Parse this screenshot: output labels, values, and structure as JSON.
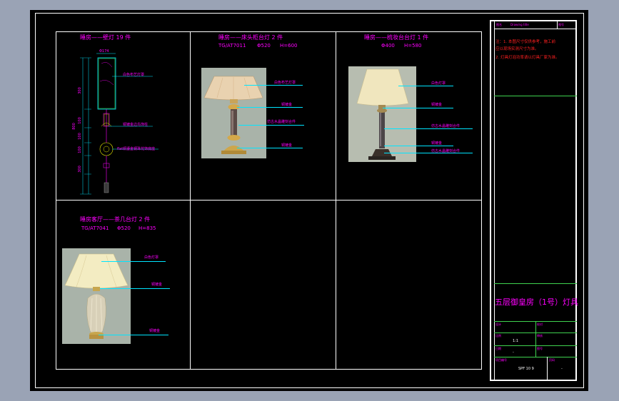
{
  "panels": [
    {
      "title": "睡房——壁灯 19 件",
      "dim_width": "Φ174",
      "dims": [
        "300",
        "300",
        "100",
        "100",
        "100",
        "300"
      ],
      "total_dim": "800",
      "labels": [
        "白色布艺灯罩",
        "铜镀金边鸟饰柱",
        "flat铜鎏金钢珠花饰底座"
      ]
    },
    {
      "title": "睡房——床头柜台灯 2 件",
      "spec": "TG/AT7011",
      "diam": "Φ520",
      "height": "H=600",
      "labels": [
        "白色布艺灯罩",
        "铜镀金",
        "仿古水晶雕刻合件",
        "铜镀金"
      ]
    },
    {
      "title": "睡房——梳妆台台灯 1 件",
      "diam": "Φ400",
      "height": "H=580",
      "labels": [
        "白色灯罩",
        "铜镀金",
        "仿古水晶雕刻合件",
        "铜镀金",
        "仿古水晶雕刻合件"
      ]
    },
    {
      "title": "睡房客厅——茶几台灯 2 件",
      "spec": "TG/AT7041",
      "diam": "Φ520",
      "height": "H=835",
      "labels": [
        "白色灯罩",
        "铜镀金",
        "铜镀金"
      ]
    }
  ],
  "title_block": {
    "header_left": "图名",
    "header_mid": "Drawing  title",
    "header_right": "图号",
    "notes": [
      "注：1. 本图尺寸仅供参考，施工前",
      "        应以现场实测尺寸为准。",
      "    2. 灯具灯泡功率请以灯具厂家为准。"
    ],
    "drawing_name": "五层御皇房（1号）灯具",
    "row_labels": [
      "设计",
      "校对",
      "比例",
      "审核",
      "日期",
      "图号",
      "项目编号",
      "页码"
    ],
    "scale": "1:1",
    "dash": "-",
    "drawing_no": "SPF 10 9",
    "page": "-"
  }
}
